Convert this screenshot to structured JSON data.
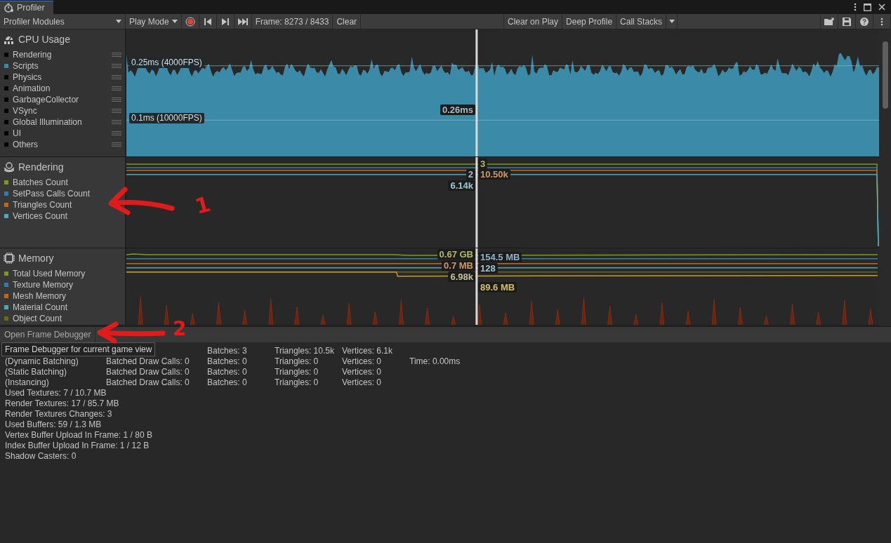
{
  "window": {
    "tab_title": "Profiler"
  },
  "toolbar": {
    "modules_dropdown": "Profiler Modules",
    "play_mode": "Play Mode",
    "recording": true,
    "frame": "Frame: 8273 / 8433",
    "clear": "Clear",
    "clear_on_play": "Clear on Play",
    "deep_profile": "Deep Profile",
    "call_stacks": "Call Stacks"
  },
  "modules": [
    {
      "kind": "cpu",
      "title": "CPU Usage",
      "series": [
        {
          "name": "Rendering",
          "color": "#000000"
        },
        {
          "name": "Scripts",
          "color": "#3a87a8"
        },
        {
          "name": "Physics",
          "color": "#000000"
        },
        {
          "name": "Animation",
          "color": "#000000"
        },
        {
          "name": "GarbageCollector",
          "color": "#000000"
        },
        {
          "name": "VSync",
          "color": "#000000"
        },
        {
          "name": "Global Illumination",
          "color": "#000000"
        },
        {
          "name": "UI",
          "color": "#000000"
        },
        {
          "name": "Others",
          "color": "#000000"
        }
      ],
      "guides": [
        "0.25ms (4000FPS)",
        "0.1ms (10000FPS)"
      ],
      "readouts": [
        {
          "text": "0.26ms"
        }
      ]
    },
    {
      "kind": "rendering",
      "title": "Rendering",
      "series": [
        {
          "name": "Batches Count",
          "color": "#7c9a1e"
        },
        {
          "name": "SetPass Calls Count",
          "color": "#2f7ea3"
        },
        {
          "name": "Triangles Count",
          "color": "#c2661a"
        },
        {
          "name": "Vertices Count",
          "color": "#4ea8b8"
        }
      ],
      "readouts": [
        {
          "text": "3",
          "color": "#b4b86a"
        },
        {
          "text": "2"
        },
        {
          "text": "10.50k",
          "color": "#d09a62"
        },
        {
          "text": "6.14k",
          "color": "#9ccad4"
        }
      ]
    },
    {
      "kind": "memory",
      "title": "Memory",
      "series": [
        {
          "name": "Total Used Memory",
          "color": "#7c9a1e"
        },
        {
          "name": "Texture Memory",
          "color": "#2f7ea3"
        },
        {
          "name": "Mesh Memory",
          "color": "#c2661a"
        },
        {
          "name": "Material Count",
          "color": "#4ea8b8"
        },
        {
          "name": "Object Count",
          "color": "#6a6a12"
        }
      ],
      "readouts": [
        {
          "text": "0.67 GB",
          "color": "#b4b86a"
        },
        {
          "text": "154.5 MB",
          "color": "#8fb3c8"
        },
        {
          "text": "0.7 MB",
          "color": "#d09a62"
        },
        {
          "text": "128",
          "color": "#9ccad4"
        },
        {
          "text": "6.98k",
          "color": "#c8c0a0"
        },
        {
          "text": "89.6 MB",
          "color": "#d4c060"
        }
      ]
    }
  ],
  "details": {
    "button": "Open Frame Debugger",
    "tooltip": "Frame Debugger for current game view",
    "rows": [
      {
        "cells": [
          null,
          null,
          "Batches: 3",
          "Triangles: 10.5k",
          "Vertices: 6.1k",
          null
        ]
      },
      {
        "cells": [
          "(Dynamic Batching)",
          "Batched Draw Calls: 0",
          "Batches: 0",
          "Triangles: 0",
          "Vertices: 0",
          "Time: 0.00ms"
        ]
      },
      {
        "cells": [
          "(Static Batching)",
          "Batched Draw Calls: 0",
          "Batches: 0",
          "Triangles: 0",
          "Vertices: 0",
          null
        ]
      },
      {
        "cells": [
          "(Instancing)",
          "Batched Draw Calls: 0",
          "Batches: 0",
          "Triangles: 0",
          "Vertices: 0",
          null
        ]
      }
    ],
    "lines": [
      "Used Textures: 7 / 10.7 MB",
      "Render Textures: 17 / 85.7 MB",
      "Render Textures Changes: 3",
      "Used Buffers: 59 / 1.3 MB",
      "Vertex Buffer Upload In Frame: 1 / 80 B",
      "Index Buffer Upload In Frame: 1 / 12 B",
      "Shadow Casters: 0"
    ]
  },
  "annotations": [
    {
      "label": "1"
    },
    {
      "label": "2"
    }
  ]
}
